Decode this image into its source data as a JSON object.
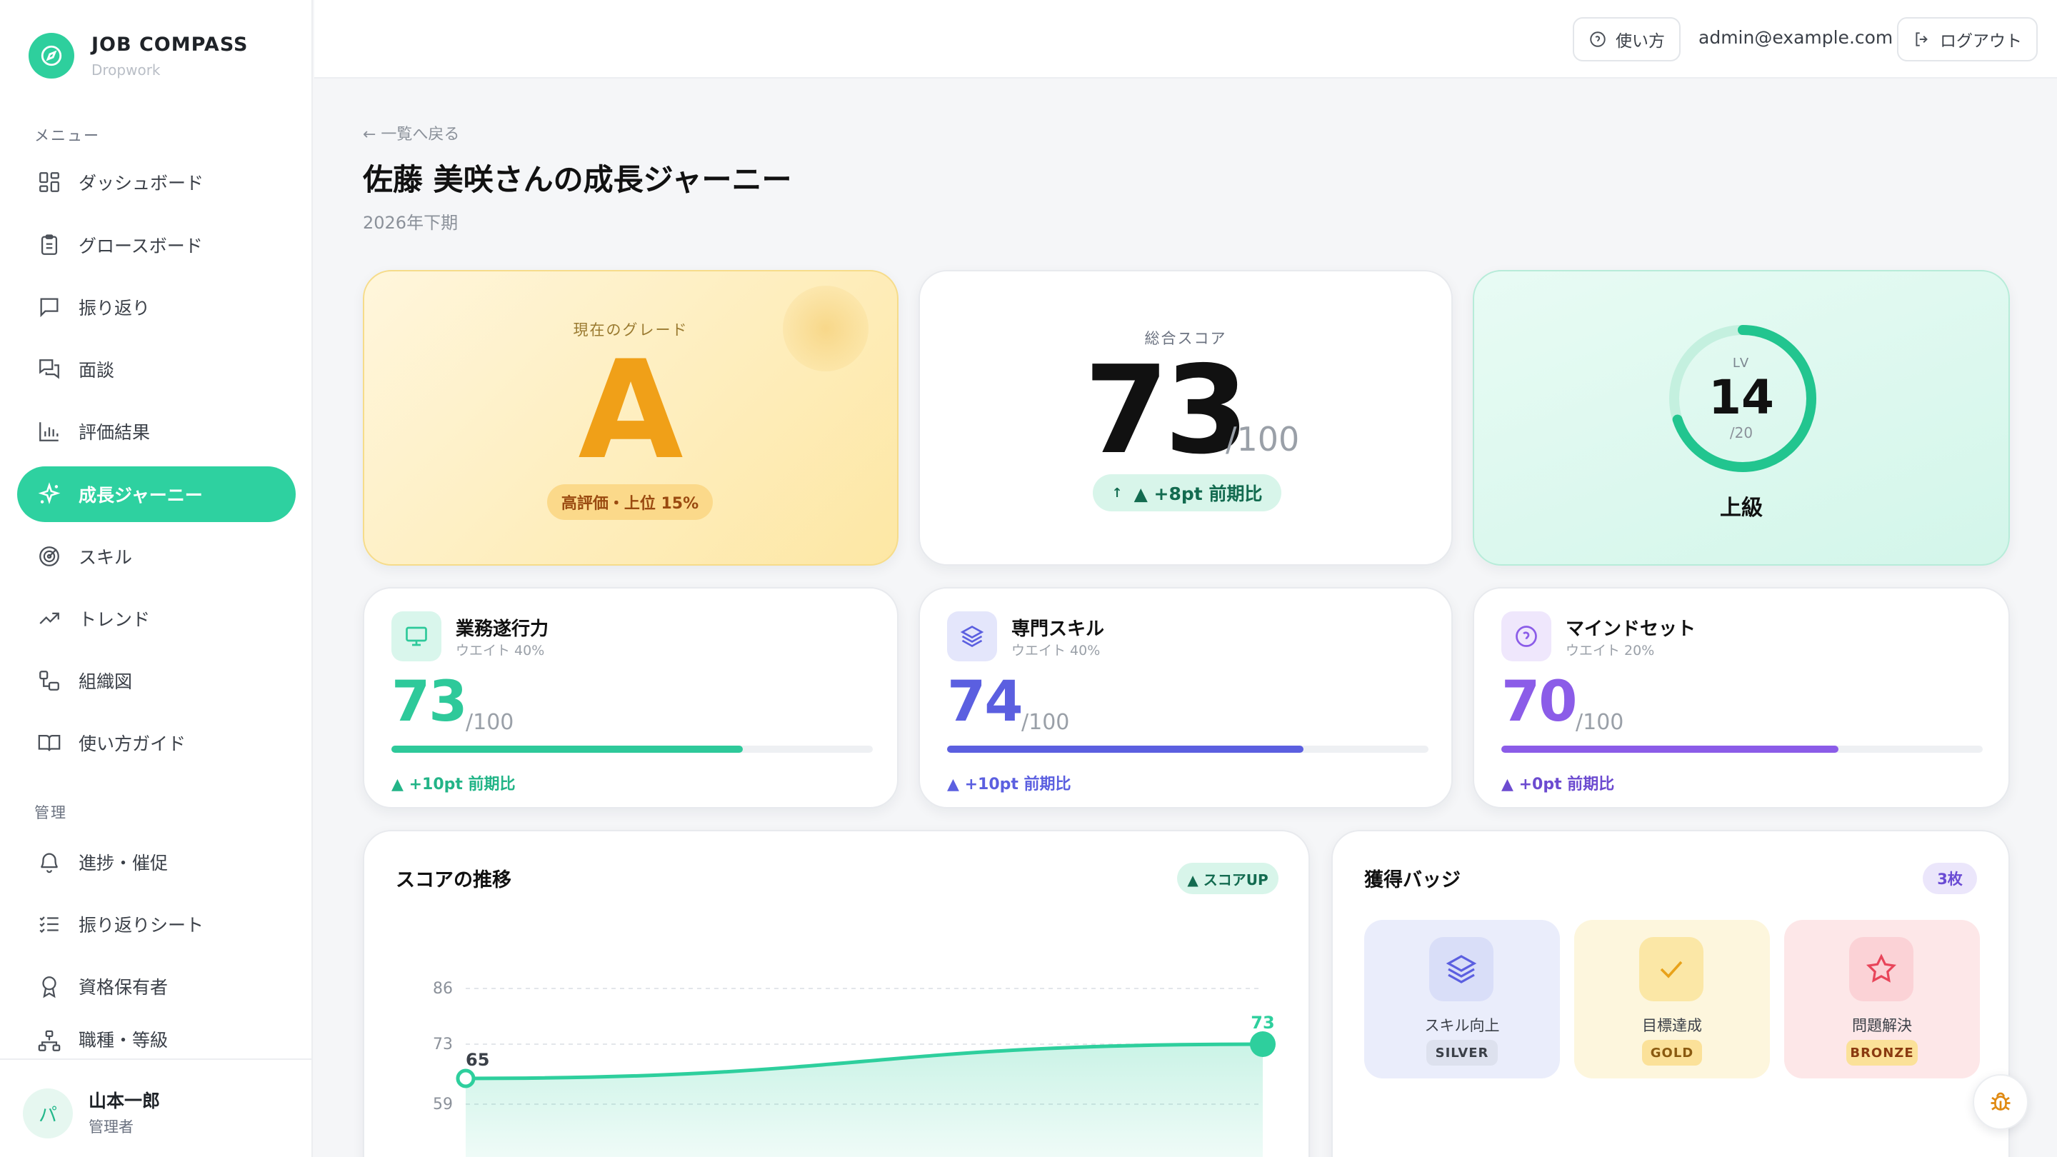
{
  "app": {
    "name": "JOB COMPASS",
    "subname": "Dropwork"
  },
  "sidebar": {
    "menu_label": "メニュー",
    "items": [
      {
        "label": "ダッシュボード",
        "icon": "grid-icon"
      },
      {
        "label": "グロースボード",
        "icon": "clipboard-icon"
      },
      {
        "label": "振り返り",
        "icon": "chat-icon"
      },
      {
        "label": "面談",
        "icon": "chats-icon"
      },
      {
        "label": "評価結果",
        "icon": "bar-chart-icon"
      },
      {
        "label": "成長ジャーニー",
        "icon": "sparkle-icon",
        "active": true
      },
      {
        "label": "スキル",
        "icon": "target-icon"
      },
      {
        "label": "トレンド",
        "icon": "trend-icon"
      },
      {
        "label": "組織図",
        "icon": "org-icon"
      },
      {
        "label": "使い方ガイド",
        "icon": "book-icon"
      }
    ],
    "admin_label": "管理",
    "admin_items": [
      {
        "label": "進捗・催促",
        "icon": "bell-icon"
      },
      {
        "label": "振り返りシート",
        "icon": "checklist-icon"
      },
      {
        "label": "資格保有者",
        "icon": "award-icon"
      },
      {
        "label": "職種・等級",
        "icon": "hierarchy-icon"
      }
    ],
    "user": {
      "initial": "パ",
      "name": "山本一郎",
      "role": "管理者"
    }
  },
  "header": {
    "help_label": "使い方",
    "email": "admin@example.com",
    "logout_label": "ログアウト"
  },
  "page": {
    "back_link": "← 一覧へ戻る",
    "title": "佐藤 美咲さんの成長ジャーニー",
    "period": "2026年下期"
  },
  "grade": {
    "label": "現在のグレード",
    "value": "A",
    "pill": "高評価・上位 15%"
  },
  "score": {
    "label": "総合スコア",
    "value": "73",
    "max": "/100",
    "delta": "▲ +8pt 前期比",
    "delta_icon": "↑"
  },
  "level": {
    "label": "LV",
    "value": "14",
    "max": "/20",
    "progress": 0.7,
    "name": "上級"
  },
  "metrics": [
    {
      "title": "業務遂行力",
      "weight": "ウエイト 40%",
      "value": "73",
      "max": "/100",
      "progress": 0.73,
      "delta": "▲ +10pt 前期比",
      "color": "#2ec99a",
      "icon": "monitor-icon"
    },
    {
      "title": "専門スキル",
      "weight": "ウエイト 40%",
      "value": "74",
      "max": "/100",
      "progress": 0.74,
      "delta": "▲ +10pt 前期比",
      "color": "#5b5fe0",
      "icon": "layers-icon"
    },
    {
      "title": "マインドセット",
      "weight": "ウエイト 20%",
      "value": "70",
      "max": "/100",
      "progress": 0.7,
      "delta": "▲ +0pt 前期比",
      "color": "#8b5ce8",
      "icon": "question-icon"
    }
  ],
  "trend": {
    "title": "スコアの推移",
    "badge": "▲ スコアUP",
    "chart_data": {
      "type": "area",
      "y_ticks": [
        59,
        73,
        86
      ],
      "ylim": [
        50,
        90
      ],
      "values": [
        65,
        73
      ],
      "point_labels": [
        "65",
        "73"
      ]
    }
  },
  "badges": {
    "title": "獲得バッジ",
    "count": "3枚",
    "items": [
      {
        "name": "スキル向上",
        "tier": "SILVER",
        "icon": "layers-icon"
      },
      {
        "name": "目標達成",
        "tier": "GOLD",
        "icon": "check-icon"
      },
      {
        "name": "問題解決",
        "tier": "BRONZE",
        "icon": "star-icon"
      }
    ]
  },
  "colors": {
    "accent": "#2ed1a0",
    "grade": "#f0a018",
    "skill": "#5b5fe0",
    "mindset": "#8b5ce8"
  }
}
